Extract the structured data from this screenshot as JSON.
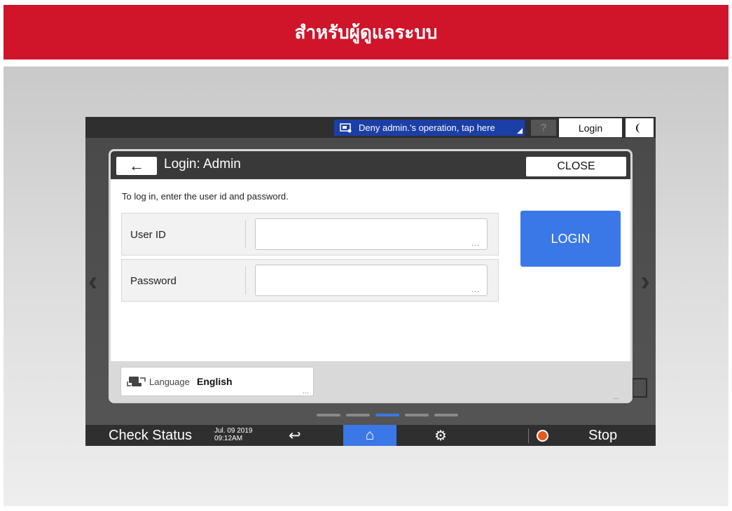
{
  "banner": {
    "title": "สำหรับผู้ดูแลระบบ"
  },
  "device": {
    "topbar": {
      "deny_label": "Deny admin.'s operation, tap here",
      "help_label": "?",
      "login_label": "Login",
      "moon_icon": "moon-icon"
    },
    "dialog": {
      "back_icon": "←",
      "title": "Login: Admin",
      "close_label": "CLOSE",
      "instruction": "To log in, enter the user id and password.",
      "fields": [
        {
          "label": "User ID",
          "value": "",
          "dots": "..."
        },
        {
          "label": "Password",
          "value": "",
          "dots": "..."
        }
      ],
      "login_button": "LOGIN",
      "language": {
        "label": "Language",
        "value": "English",
        "dots": "..."
      },
      "footer_dots": "..."
    },
    "page_indicator": {
      "count": 5,
      "active_index": 2
    },
    "bottombar": {
      "check_status": "Check Status",
      "date": "Jul. 09 2019",
      "time": "09:12AM",
      "back_icon": "↩",
      "home_icon": "⌂",
      "gear_icon": "⚙",
      "stop_label": "Stop"
    }
  },
  "colors": {
    "banner_red": "#d0142a",
    "accent_blue": "#3b78e7",
    "deny_blue": "#1b3fa6",
    "stop_orange": "#e55a1c"
  }
}
